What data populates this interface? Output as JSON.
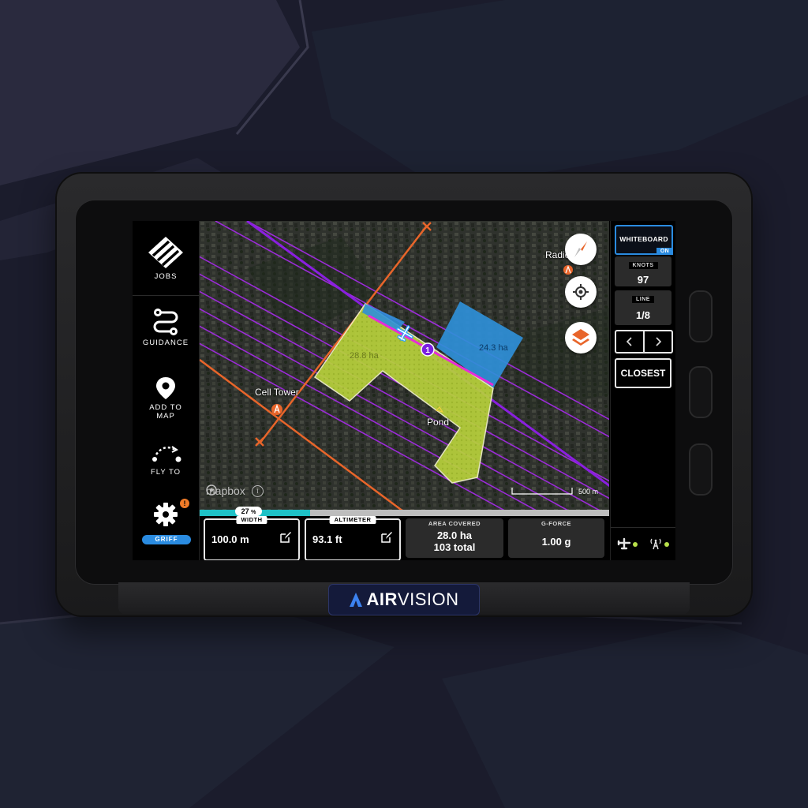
{
  "brand": {
    "name_bold": "AIR",
    "name_light": "VISION"
  },
  "sidebar": {
    "items": [
      {
        "label": "JOBS",
        "icon": "jobs-logo-icon"
      },
      {
        "label": "GUIDANCE",
        "icon": "route-icon"
      },
      {
        "label": "ADD TO",
        "label2": "MAP",
        "icon": "map-pin-icon"
      },
      {
        "label": "FLY TO",
        "icon": "fly-to-icon"
      }
    ],
    "settings": {
      "icon": "gear-icon",
      "alert": "!",
      "user": "GRIFF"
    }
  },
  "map": {
    "labels": {
      "radio": "Radio",
      "cell_tower": "Cell Tower",
      "pond": "Pond",
      "area_green": "28.8 ha",
      "area_blue": "24.3 ha",
      "waypoint": "1",
      "scale": "500 m",
      "attribution": "mapbox"
    },
    "buttons": [
      "compass-icon",
      "locate-icon",
      "layers-icon"
    ],
    "colors": {
      "field": "#b6d13a",
      "block": "#2f8fd8",
      "lines": "#9b2bd8",
      "active_line": "#e82bd8",
      "boundary": "#e8652a"
    }
  },
  "progress": {
    "value": 27,
    "label": "27",
    "unit": "%"
  },
  "info": {
    "width": {
      "tag": "WIDTH",
      "value": "100.0 m"
    },
    "altimeter": {
      "tag": "ALTIMETER",
      "value": "93.1 ft"
    },
    "area": {
      "tag": "AREA COVERED",
      "line1": "28.0 ha",
      "line2": "103 total"
    },
    "gforce": {
      "tag": "G-FORCE",
      "value": "1.00 g"
    }
  },
  "right_panel": {
    "whiteboard": {
      "label": "WHITEBOARD",
      "state": "ON"
    },
    "knots": {
      "tag": "KNOTS",
      "value": "97"
    },
    "line": {
      "tag": "LINE",
      "value": "1/8"
    },
    "prev": "‹",
    "next": "›",
    "closest": "CLOSEST",
    "status": [
      "aircraft-icon",
      "radio-tower-icon"
    ]
  }
}
